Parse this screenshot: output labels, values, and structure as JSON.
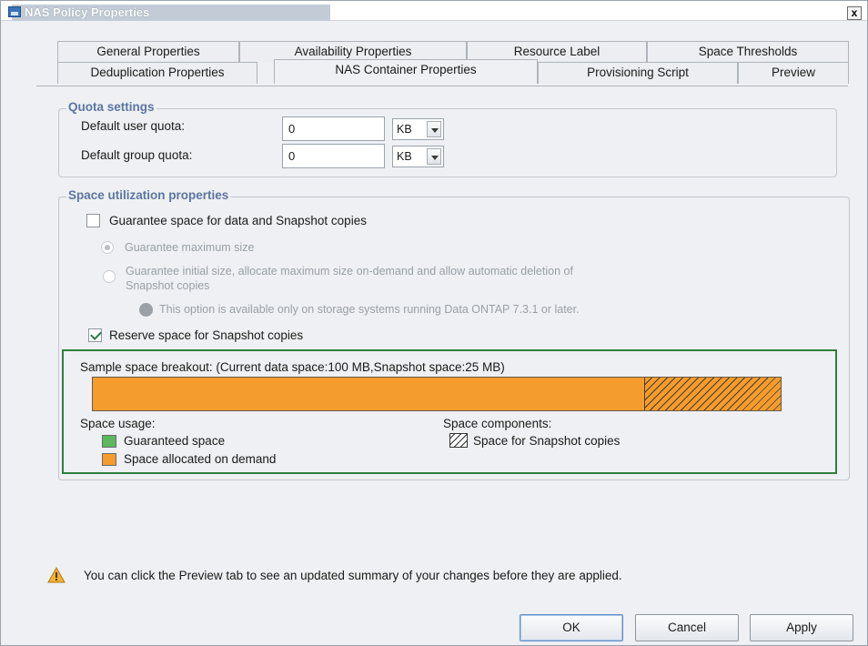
{
  "window": {
    "title": "NAS Policy Properties",
    "close_label": "x"
  },
  "tabs": {
    "row1": [
      "General Properties",
      "Availability Properties",
      "Resource Label",
      "Space Thresholds"
    ],
    "row2": [
      "Deduplication Properties",
      "NAS Container Properties",
      "Provisioning Script",
      "Preview"
    ],
    "active": "NAS Container Properties"
  },
  "quota": {
    "title": "Quota settings",
    "user_label": "Default user quota:",
    "user_value": "0",
    "user_unit": "KB",
    "group_label": "Default group quota:",
    "group_value": "0",
    "group_unit": "KB"
  },
  "space": {
    "title": "Space utilization properties",
    "guarantee_label": "Guarantee space for data and Snapshot copies",
    "guarantee_checked": false,
    "radio1_label": "Guarantee maximum size",
    "radio2_label_line1": "Guarantee initial size, allocate maximum size on-demand and allow automatic deletion of",
    "radio2_label_line2": "Snapshot copies",
    "info_note": "This option is available only on storage systems running Data ONTAP 7.3.1 or later.",
    "reserve_label": "Reserve space for Snapshot copies",
    "reserve_checked": true
  },
  "breakout": {
    "caption": "Sample space breakout: (Current data space:100 MB,Snapshot space:25 MB)",
    "usage_title": "Space usage:",
    "components_title": "Space components:",
    "legend_guaranteed": "Guaranteed space",
    "legend_on_demand": "Space allocated on demand",
    "legend_snapshot": "Space for Snapshot copies",
    "colors": {
      "guaranteed": "#5cb85c",
      "on_demand": "#f49c2e"
    }
  },
  "footer": {
    "hint": "You can click the Preview tab to see an updated summary of your changes before they are applied."
  },
  "buttons": {
    "ok": "OK",
    "cancel": "Cancel",
    "apply": "Apply"
  }
}
